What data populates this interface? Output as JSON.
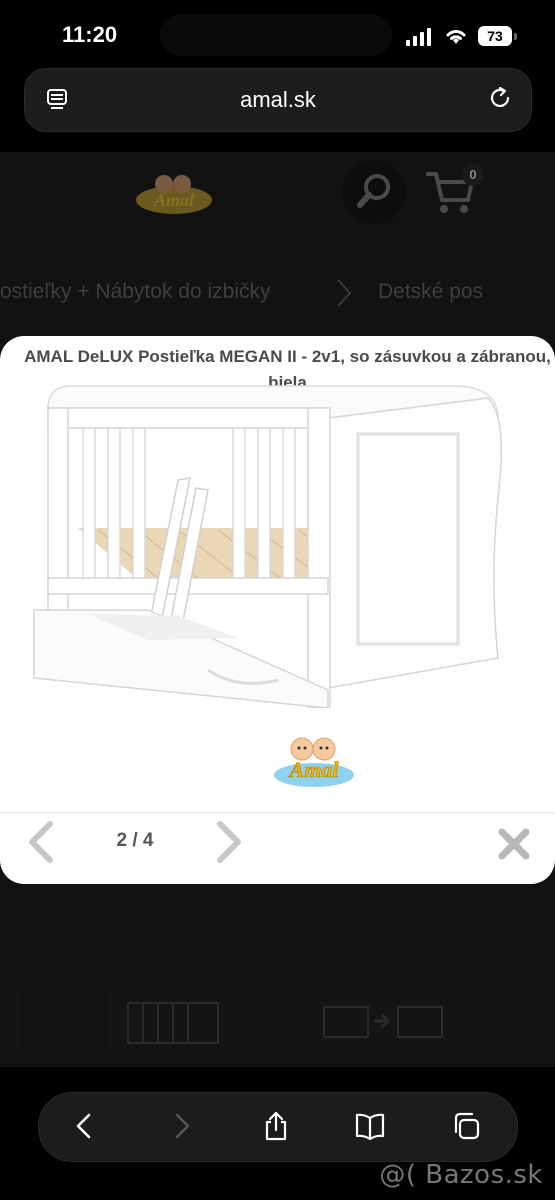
{
  "status": {
    "time": "11:20",
    "battery": "73"
  },
  "browser": {
    "url": "amal.sk"
  },
  "site": {
    "cart_count": "0",
    "breadcrumb": [
      "ostieľky + Nábytok do izbičky",
      "Detské pos"
    ]
  },
  "gallery": {
    "title": "AMAL DeLUX Postieľka MEGAN II - 2v1, so zásuvkou a zábranou, biela",
    "counter": "2 / 4",
    "logo_text": "Amal"
  },
  "watermark": "@( Bazos.sk",
  "icons": [
    "tabs-menu-icon",
    "reload-icon",
    "search-icon",
    "cart-icon",
    "chevron-left-icon",
    "chevron-right-icon",
    "close-icon",
    "back-icon",
    "forward-icon",
    "share-icon",
    "bookmarks-icon",
    "tabs-icon"
  ]
}
